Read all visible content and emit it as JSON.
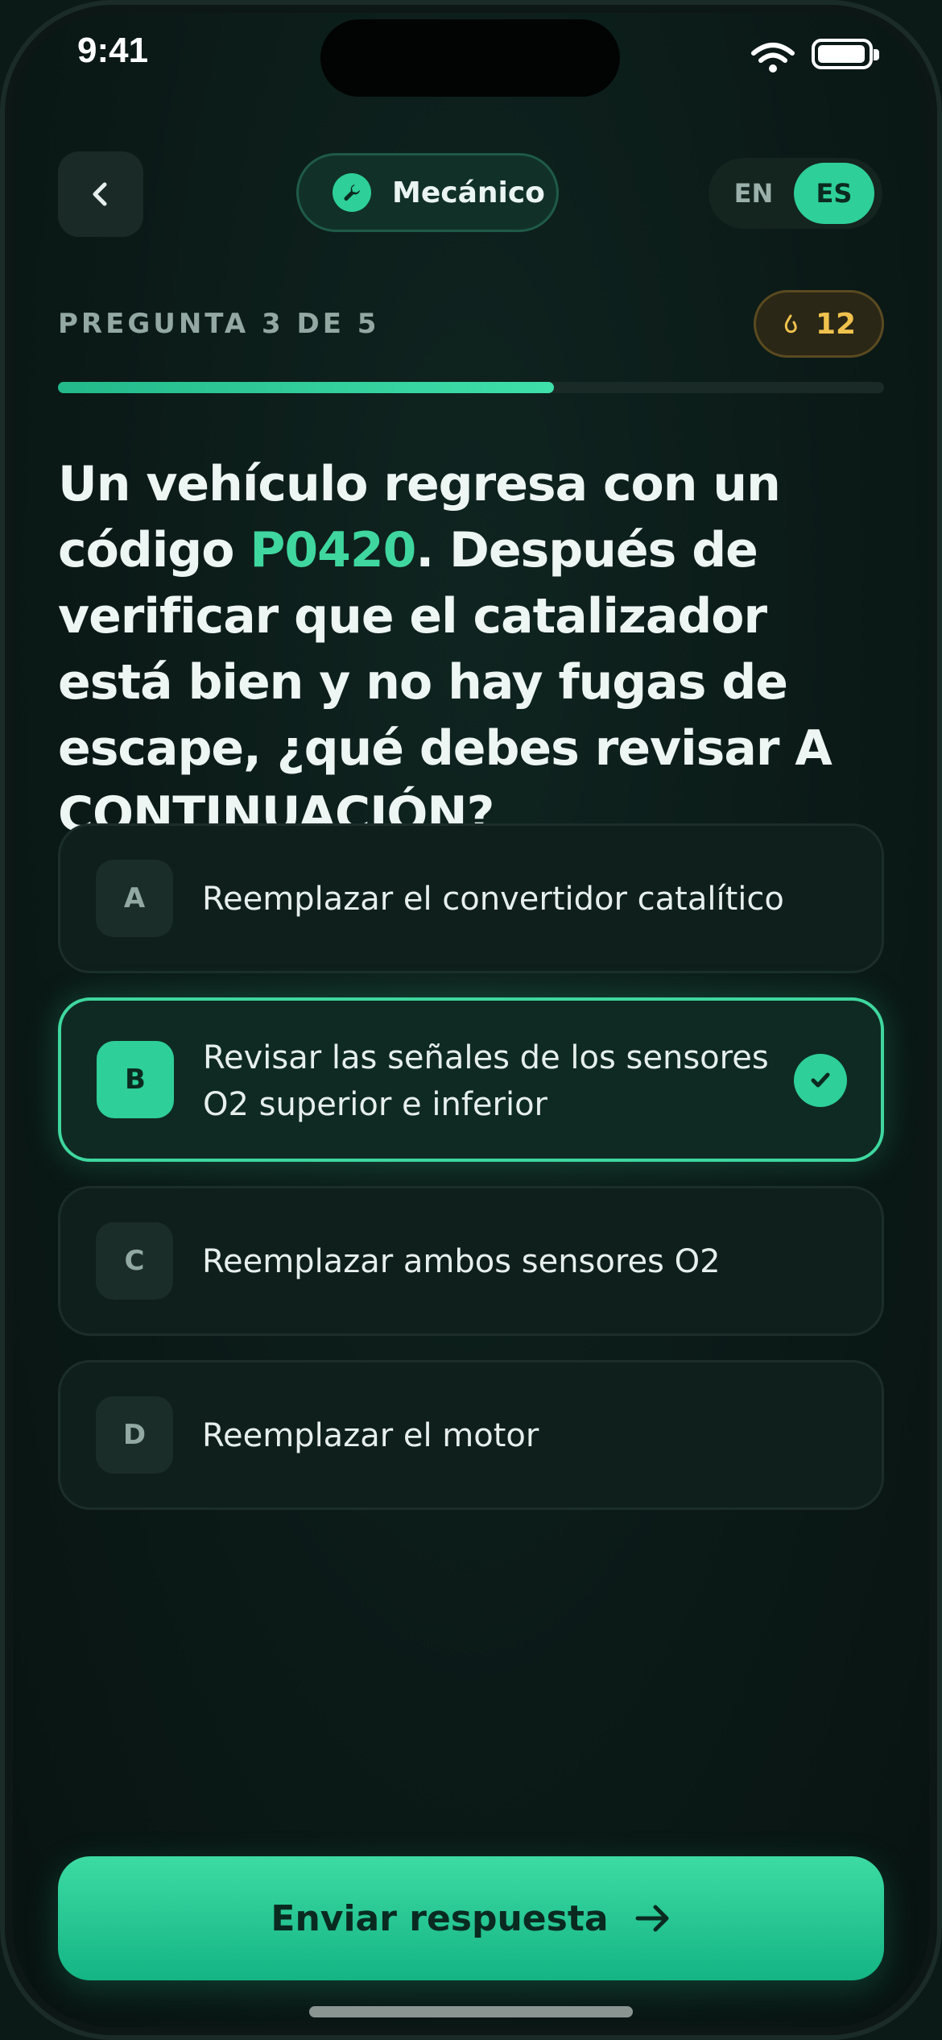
{
  "status_bar": {
    "time": "9:41"
  },
  "header": {
    "category": "Mecánico",
    "category_icon": "wrench-icon",
    "languages": [
      {
        "code": "EN",
        "active": false
      },
      {
        "code": "ES",
        "active": true
      }
    ]
  },
  "progress": {
    "counter_label": "PREGUNTA 3 DE 5",
    "fraction": 0.6,
    "streak_count": "12",
    "streak_icon": "flame-icon",
    "accent": "#2ecf98"
  },
  "question": {
    "text_before": "Un vehículo regresa con un código ",
    "code": "P0420",
    "text_after": ". Después de verificar que el catalizador está bien y no hay fugas de escape, ¿qué debes revisar A CONTINUACIÓN?"
  },
  "options": [
    {
      "letter": "A",
      "text": "Reemplazar el convertidor catalítico",
      "selected": false
    },
    {
      "letter": "B",
      "text": "Revisar las señales de los sensores O2 superior e inferior",
      "selected": true
    },
    {
      "letter": "C",
      "text": "Reemplazar ambos sensores O2",
      "selected": false
    },
    {
      "letter": "D",
      "text": "Reemplazar el motor",
      "selected": false
    }
  ],
  "submit": {
    "label": "Enviar respuesta",
    "icon": "arrow-right-icon"
  }
}
